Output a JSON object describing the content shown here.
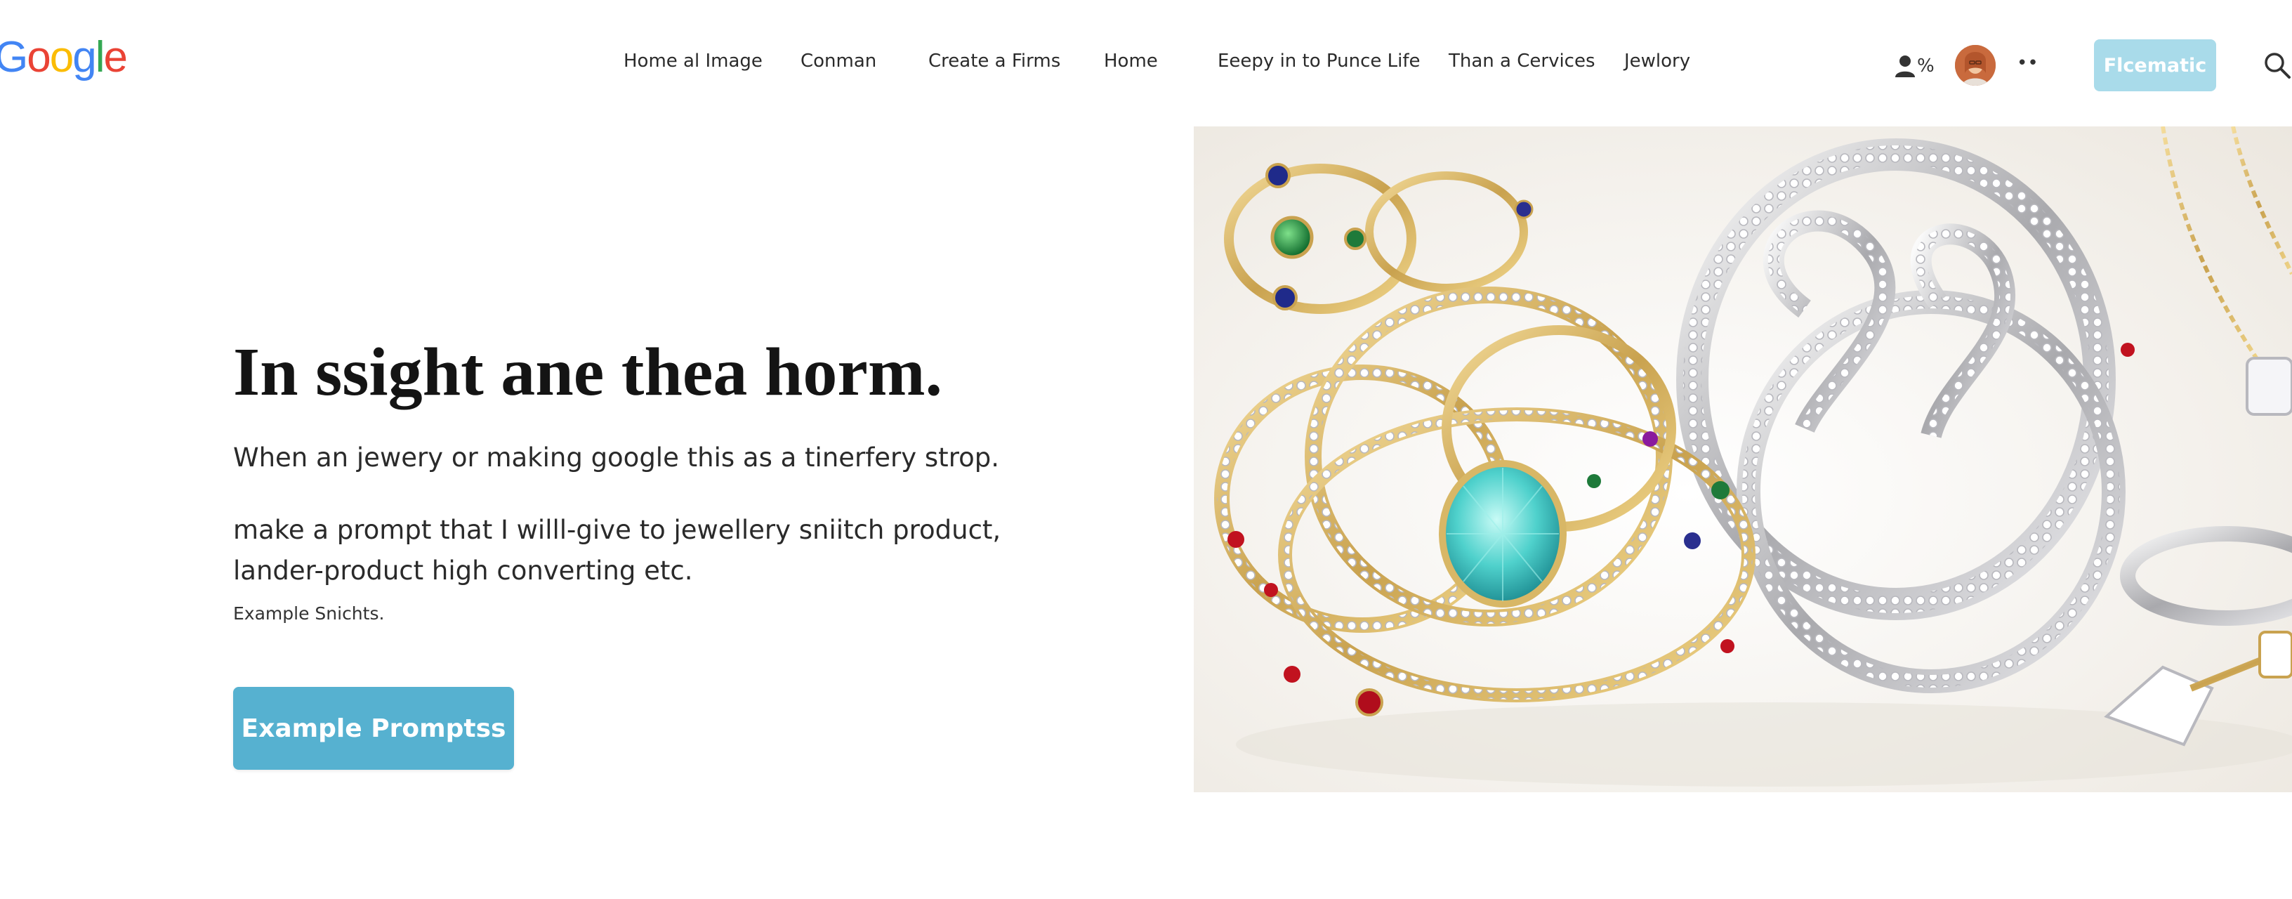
{
  "brand": {
    "logo_letters": [
      "G",
      "o",
      "o",
      "g",
      "l",
      "e"
    ],
    "logo_colors": [
      "#4285F4",
      "#EA4335",
      "#FBBC05",
      "#4285F4",
      "#34A853",
      "#EA4335"
    ]
  },
  "nav": {
    "items": [
      {
        "label": "Home al Image"
      },
      {
        "label": "Conman"
      },
      {
        "label": "Create a Firms"
      },
      {
        "label": "Home"
      },
      {
        "label": "Eeepy in to Punce Life"
      },
      {
        "label": "Than a Cervices"
      },
      {
        "label": "Jewlory"
      }
    ]
  },
  "header_actions": {
    "user_badge": "%",
    "user_icon": "user-icon",
    "more": "••",
    "cta_label": "Flcematic",
    "cta_color": "#a9dbea",
    "search_icon": "search-icon"
  },
  "hero": {
    "title": "In ssight ane thea horm.",
    "subtitle": "When an jewery or making google this as a tinerfery strop.",
    "body": "make a prompt that I willl-give to  jewellery sniitch product, lander-product high converting etc.",
    "small": "Example Snichts.",
    "button_label": "Example Promptss",
    "button_color": "#56b1d0"
  }
}
